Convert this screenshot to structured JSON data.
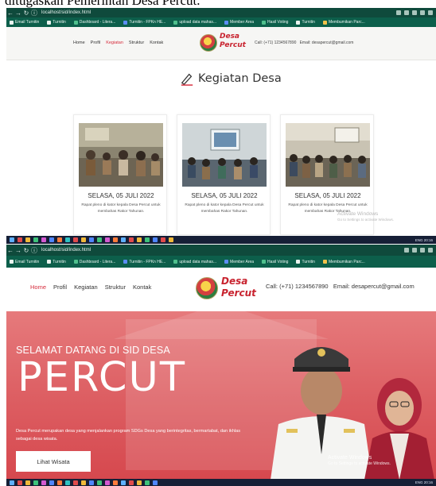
{
  "caption": "ditugaskan Pemerintah Desa Percut.",
  "browser": {
    "url": "localhost/sid/index.html",
    "bookmarks": [
      {
        "label": "Email Turnitin",
        "icon": "bookmark-icon"
      },
      {
        "label": "Turnitin",
        "icon": "turnitin-icon"
      },
      {
        "label": "Dashboard - Litera...",
        "icon": "globe-icon"
      },
      {
        "label": "Turnitin - FPKn HE...",
        "icon": "turnitin-icon"
      },
      {
        "label": "upload data mahas...",
        "icon": "globe-icon"
      },
      {
        "label": "Member Area",
        "icon": "member-icon"
      },
      {
        "label": "Hasil Voting",
        "icon": "globe-icon"
      },
      {
        "label": "Turnitin",
        "icon": "turnitin-icon"
      },
      {
        "label": "Membumikan Parc...",
        "icon": "bookmark-icon"
      }
    ]
  },
  "site": {
    "nav": [
      "Home",
      "Profil",
      "Kegiatan",
      "Struktur",
      "Kontak"
    ],
    "logo_line1": "Desa",
    "logo_line2": "Percut",
    "contact_call": "Call: (+71) 1234567890",
    "contact_email": "Email: desapercut@gmail.com"
  },
  "kegiatan": {
    "title": "Kegiatan Desa",
    "cards": [
      {
        "date": "SELASA, 05 JULI 2022",
        "desc": "Rapat pleno di kator kepala Desa Percut untuk membahas Rakor Tahunan."
      },
      {
        "date": "SELASA, 05 JULI 2022",
        "desc": "Rapat pleno di kator kepala Desa Percut untuk membahas Rakor Tahunan."
      },
      {
        "date": "SELASA, 05 JULI 2022",
        "desc": "Rapat pleno di kator kepala Desa Percut untuk membahas Rakor Tahunan."
      }
    ]
  },
  "hero": {
    "welcome": "SELAMAT DATANG DI SID DESA",
    "big": "PERCUT",
    "blurb": "Desa Percut merupakan desa yang menjalankan program SDGs Desa yang berintegritas, bermartabat, dan ikhlas sebagai desa wisata.",
    "cta": "Lihat Wisata"
  },
  "windows_notice": {
    "title": "Activate Windows",
    "sub": "Go to Settings to activate Windows."
  },
  "taskbar": {
    "clock": "ENG 20:16"
  },
  "colors": {
    "chrome": "#0f4a3c",
    "bookmarks_bar": "#0d5f4b",
    "accent_red": "#d62c3c",
    "hero_red": "#dd5f63",
    "taskbar": "#161f36"
  }
}
